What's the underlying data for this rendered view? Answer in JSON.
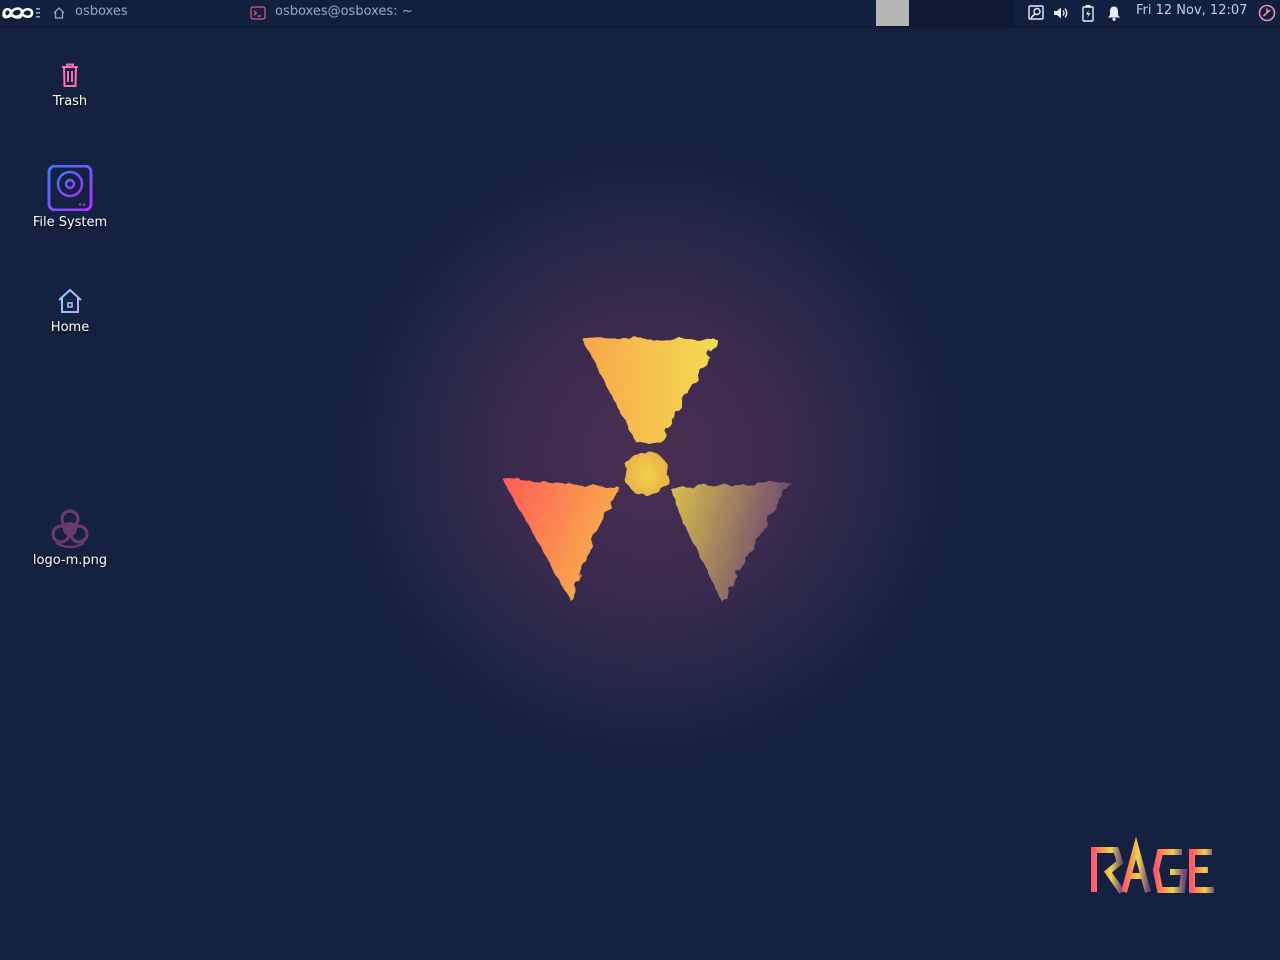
{
  "panel": {
    "app_menu_icon": "infinity-icon",
    "places_label": "osboxes",
    "places_icon": "home-icon",
    "window_title": "osboxes@osboxes: ~",
    "window_icon": "terminal-icon",
    "tray_icons": [
      "screenshot-icon",
      "volume-icon",
      "battery-icon",
      "notification-bell-icon",
      "power-icon"
    ],
    "clock": "Fri 12 Nov, 12:07"
  },
  "desktop": {
    "icons": [
      {
        "label": "Trash",
        "icon": "trash-icon"
      },
      {
        "label": "File System",
        "icon": "drive-icon"
      },
      {
        "label": "Home",
        "icon": "home-icon"
      },
      {
        "label": "logo-m.png",
        "icon": "biohazard-image-icon"
      }
    ]
  },
  "colors": {
    "background": "#152140",
    "panel": "#12203f",
    "accent_pink": "#ff6fae",
    "accent_yellow": "#f5d24a",
    "accent_orange": "#ff6a4d"
  }
}
